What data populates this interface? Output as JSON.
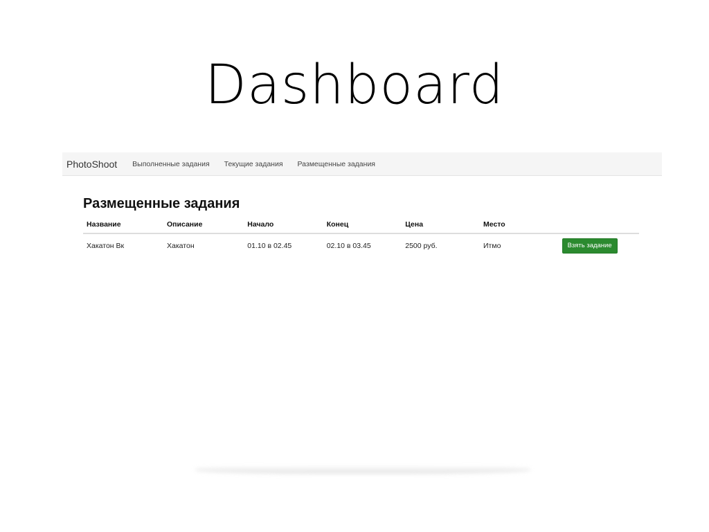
{
  "slide": {
    "title": "Dashboard"
  },
  "navbar": {
    "brand": "PhotoShoot",
    "links": [
      {
        "label": "Выполненные задания"
      },
      {
        "label": "Текущие задания"
      },
      {
        "label": "Размещенные задания"
      }
    ]
  },
  "main": {
    "heading": "Размещенные задания",
    "table": {
      "headers": [
        "Название",
        "Описание",
        "Начало",
        "Конец",
        "Цена",
        "Место"
      ],
      "rows": [
        {
          "name": "Хакатон Вк",
          "description": "Хакатон",
          "start": "01.10 в 02.45",
          "end": "02.10 в 03.45",
          "price": "2500 руб.",
          "place": "Итмо",
          "action_label": "Взять задание"
        }
      ]
    }
  },
  "colors": {
    "navbar_bg": "#f5f5f5",
    "button_bg": "#2b8a2f",
    "button_text": "#ffffff"
  }
}
